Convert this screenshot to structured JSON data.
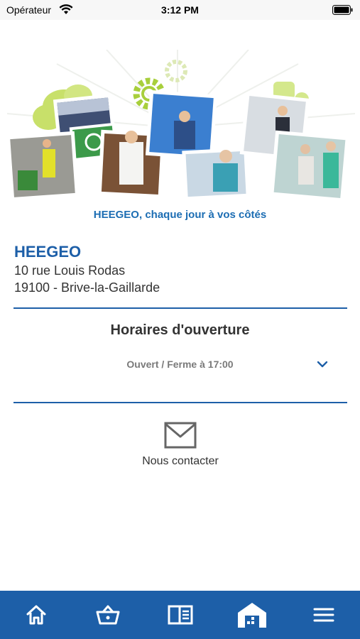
{
  "status_bar": {
    "carrier": "Opérateur",
    "time": "3:12 PM"
  },
  "banner": {
    "tagline": "HEEGEO, chaque jour à vos côtés"
  },
  "store": {
    "name": "HEEGEO",
    "address_line1": "10 rue Louis Rodas",
    "address_line2": "19100 - Brive-la-Gaillarde"
  },
  "hours": {
    "title": "Horaires d'ouverture",
    "status": "Ouvert / Ferme à 17:00"
  },
  "contact": {
    "label": "Nous contacter",
    "icon": "mail-icon"
  },
  "tab_bar": {
    "tabs": [
      {
        "icon": "home-icon"
      },
      {
        "icon": "basket-icon"
      },
      {
        "icon": "catalog-icon"
      },
      {
        "icon": "store-icon"
      },
      {
        "icon": "menu-icon"
      }
    ]
  },
  "colors": {
    "brand_blue": "#1d5fa8",
    "tagline_blue": "#1c6db3",
    "accent_green": "#a8cf3c",
    "text_dark": "#333333",
    "text_grey": "#7a7a7a"
  }
}
